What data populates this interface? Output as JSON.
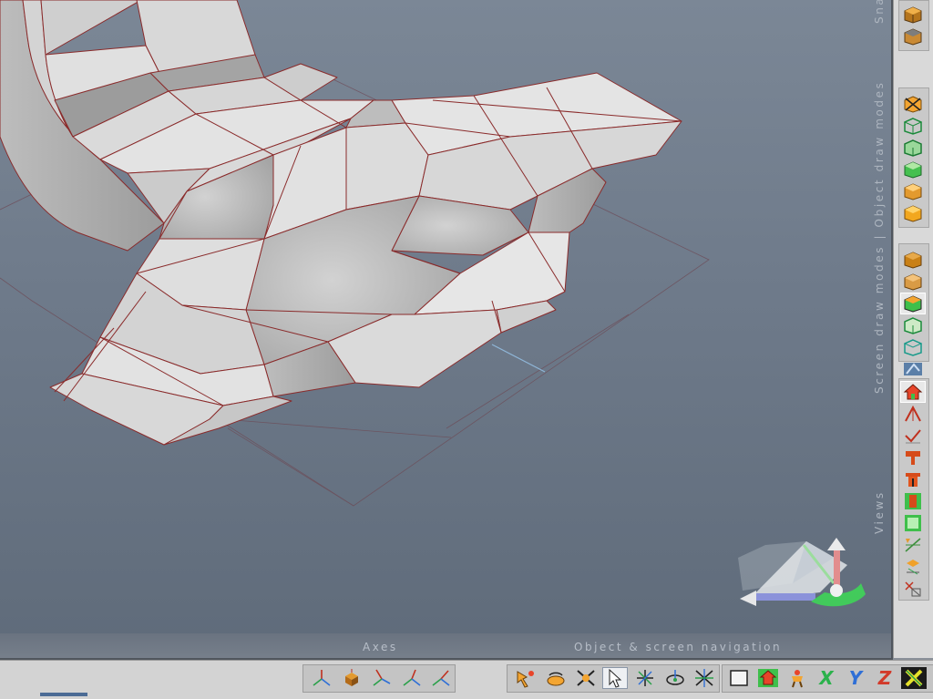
{
  "viewport": {
    "labels": {
      "axes": "Axes",
      "navigation": "Object & screen navigation",
      "views": "Views",
      "draw_modes": "Screen draw modes  |  Object draw modes",
      "snap": "Sna"
    }
  },
  "colors": {
    "viewport_top": "#7b8796",
    "viewport_bottom": "#5f6b7a",
    "mesh_face": "#dcdcdc",
    "mesh_edge": "#8a2b2b",
    "toolbar_bg": "#d9d9d9",
    "label_text": "#b7bec8"
  },
  "right_toolbar": {
    "snap_buttons": [
      "snap-box-icon",
      "snap-box-alt-icon"
    ],
    "object_draw_modes": [
      "object-wireframe-cross-icon",
      "object-wire-green-icon",
      "object-hidden-line-icon",
      "object-flat-green-icon",
      "object-shaded-icon",
      "object-solid-icon"
    ],
    "screen_draw_modes": [
      "screen-solid-icon",
      "screen-shaded-icon",
      "screen-shaded-green-icon",
      "screen-wire-green-icon",
      "screen-wire-cyan-icon",
      "screen-texture-icon"
    ],
    "views": [
      "view-home-icon",
      "view-perspective-icon",
      "view-grid-icon",
      "view-top-icon",
      "view-front-icon",
      "view-side-icon",
      "view-right-icon",
      "view-ortho-icon",
      "view-snap-icon",
      "view-reset-icon"
    ]
  },
  "bottom_toolbar": {
    "axes_buttons": [
      "axes-xyz-icon",
      "axes-object-icon",
      "axes-local-icon",
      "axes-world-icon",
      "axes-screen-icon"
    ],
    "navigation_buttons": [
      "move-object-icon",
      "rotate-object-icon",
      "scale-object-icon",
      "select-arrow-icon",
      "pan-screen-icon",
      "orbit-screen-icon",
      "zoom-screen-icon"
    ],
    "view_buttons": [
      "frame-rect-icon",
      "home-view-icon",
      "person-icon"
    ],
    "axis_constraints": [
      "X",
      "Y",
      "Z"
    ],
    "constraint_colors": {
      "X": "#2bb24c",
      "Y": "#2f6fd6",
      "Z": "#d23a2a"
    },
    "extra": "xyz-all-icon"
  }
}
